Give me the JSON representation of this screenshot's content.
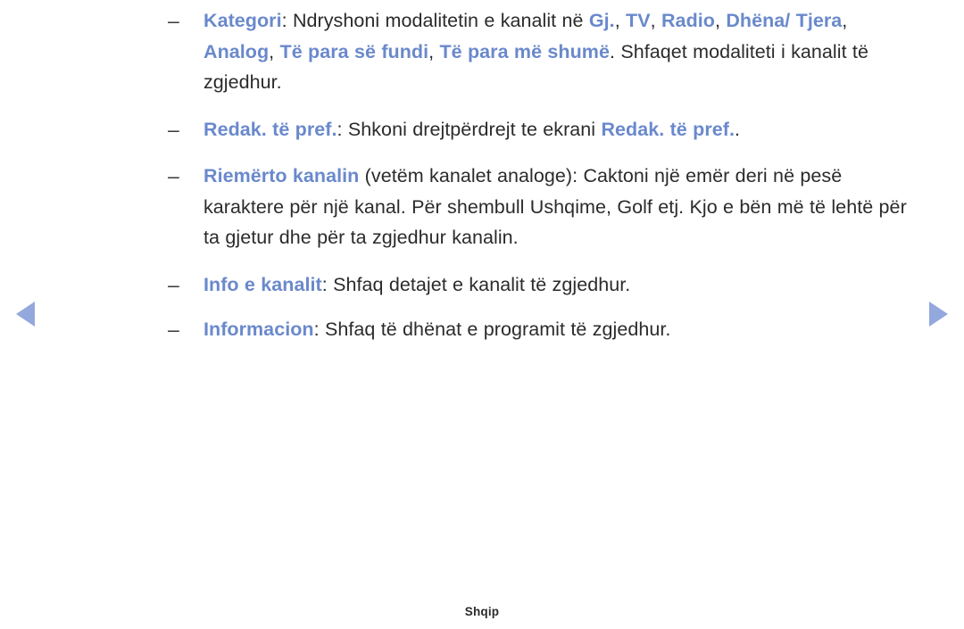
{
  "page": {
    "language_footer": "Shqip",
    "accent_color": "#6a89cc",
    "arrow_color": "#93a8dd",
    "text_color": "#2b2b2b",
    "background_color": "#ffffff"
  },
  "navigation": {
    "prev_icon": "triangle-left-icon",
    "next_icon": "triangle-right-icon"
  },
  "bullets": [
    {
      "marker": "–",
      "term": "Kategori",
      "segments": [
        {
          "type": "highlight",
          "text": "Kategori"
        },
        {
          "type": "plain",
          "text": ": Ndryshoni modalitetin e kanalit në "
        },
        {
          "type": "highlight",
          "text": "Gj."
        },
        {
          "type": "plain",
          "text": ", "
        },
        {
          "type": "highlight",
          "text": "TV"
        },
        {
          "type": "plain",
          "text": ", "
        },
        {
          "type": "highlight",
          "text": "Radio"
        },
        {
          "type": "plain",
          "text": ", "
        },
        {
          "type": "highlight",
          "text": "Dhëna/ Tjera"
        },
        {
          "type": "plain",
          "text": ", "
        },
        {
          "type": "highlight",
          "text": "Analog"
        },
        {
          "type": "plain",
          "text": ", "
        },
        {
          "type": "highlight",
          "text": "Të para së fundi"
        },
        {
          "type": "plain",
          "text": ", "
        },
        {
          "type": "highlight",
          "text": "Të para më shumë"
        },
        {
          "type": "plain",
          "text": ". Shfaqet modaliteti i kanalit të zgjedhur."
        }
      ]
    },
    {
      "marker": "–",
      "term": "Redak. të pref.",
      "segments": [
        {
          "type": "highlight",
          "text": "Redak. të pref."
        },
        {
          "type": "plain",
          "text": ": Shkoni drejtpërdrejt te ekrani "
        },
        {
          "type": "highlight",
          "text": "Redak. të pref."
        },
        {
          "type": "plain",
          "text": "."
        }
      ]
    },
    {
      "marker": "–",
      "term": "Riemërto kanalin",
      "segments": [
        {
          "type": "highlight",
          "text": "Riemërto kanalin"
        },
        {
          "type": "plain",
          "text": " (vetëm kanalet analoge): Caktoni një emër deri në pesë karaktere për një kanal. Për shembull Ushqime, Golf etj. Kjo e bën më të lehtë për ta gjetur dhe për ta zgjedhur kanalin."
        }
      ]
    },
    {
      "marker": "–",
      "term": "Info e kanalit",
      "segments": [
        {
          "type": "highlight",
          "text": "Info e kanalit"
        },
        {
          "type": "plain",
          "text": ": Shfaq detajet e kanalit të zgjedhur."
        }
      ]
    },
    {
      "marker": "–",
      "term": "Informacion",
      "segments": [
        {
          "type": "highlight",
          "text": "Informacion"
        },
        {
          "type": "plain",
          "text": ": Shfaq të dhënat e programit të zgjedhur."
        }
      ]
    }
  ]
}
